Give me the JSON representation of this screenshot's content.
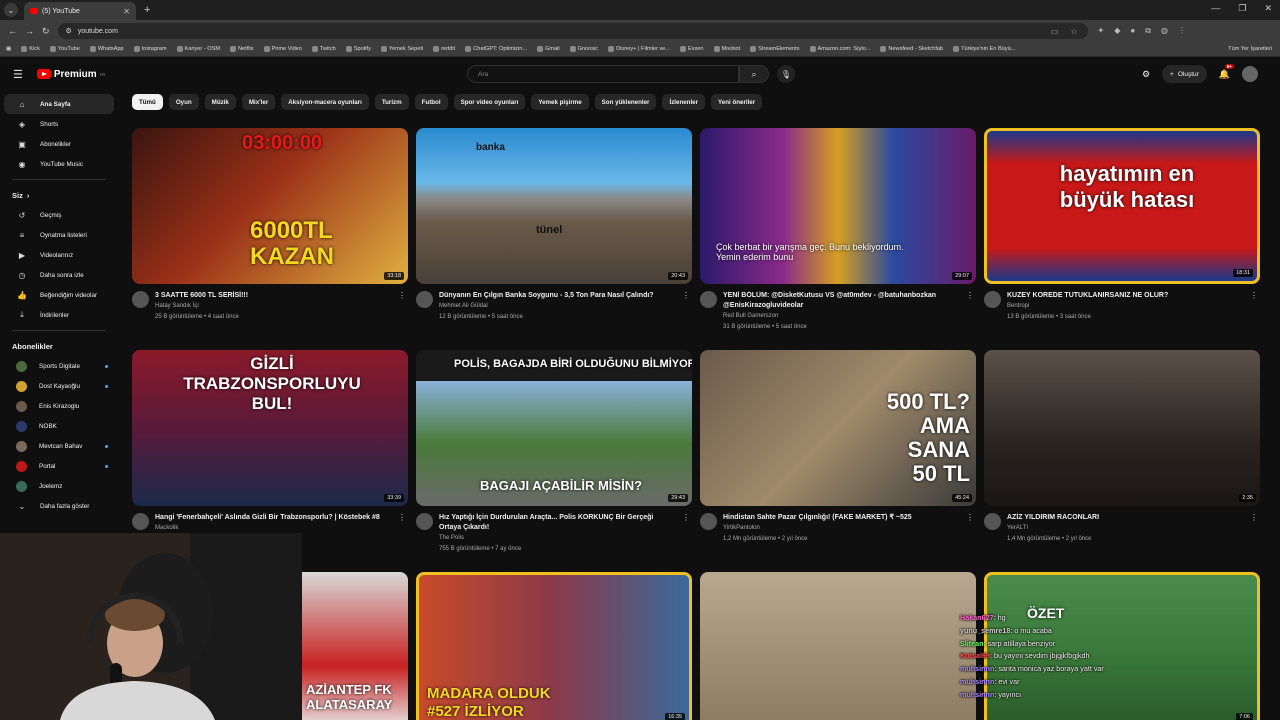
{
  "browser": {
    "tab_title": "(5) YouTube",
    "url": "youtube.com",
    "bookmarks": [
      "Kick",
      "YouTube",
      "WhatsApp",
      "Instagram",
      "Kariyer - OSM",
      "Netflix",
      "Prime Video",
      "Twitch",
      "Spotify",
      "Yemek Sepeti",
      "reddit",
      "ChatGPT: Optimizin...",
      "Gmail",
      "Gnoosic",
      "Disney+ | Filmler ve...",
      "Exxen",
      "Moobot",
      "StreamElements",
      "Amazon.com: Stylo...",
      "Newsfeed - Sketchfab",
      "Türkiye'nin En Büyü..."
    ],
    "bookmarks_all": "Tüm Yer İşaretleri"
  },
  "header": {
    "logo_text": "Premium",
    "logo_sup": "TR",
    "search_placeholder": "Ara",
    "create_label": "Oluştur",
    "notif_count": "9+"
  },
  "sidebar": {
    "main": [
      {
        "label": "Ana Sayfa",
        "icon": "home-icon",
        "glyph": "⌂"
      },
      {
        "label": "Shorts",
        "icon": "shorts-icon",
        "glyph": "◈"
      },
      {
        "label": "Abonelikler",
        "icon": "subscriptions-icon",
        "glyph": "▣"
      },
      {
        "label": "YouTube Music",
        "icon": "music-icon",
        "glyph": "◉"
      }
    ],
    "you_heading": "Siz",
    "you": [
      {
        "label": "Geçmiş",
        "icon": "history-icon",
        "glyph": "↺"
      },
      {
        "label": "Oynatma listeleri",
        "icon": "playlist-icon",
        "glyph": "≡"
      },
      {
        "label": "Videolarınız",
        "icon": "your-videos-icon",
        "glyph": "▶"
      },
      {
        "label": "Daha sonra izle",
        "icon": "watch-later-icon",
        "glyph": "◷"
      },
      {
        "label": "Beğendiğim videolar",
        "icon": "like-icon",
        "glyph": "👍"
      },
      {
        "label": "İndirilenler",
        "icon": "download-icon",
        "glyph": "⤓"
      }
    ],
    "subs_heading": "Abonelikler",
    "subs": [
      {
        "label": "Sports Digitale",
        "color": "#4a6a3a"
      },
      {
        "label": "Dost Kayaoğlu",
        "color": "#d0a030"
      },
      {
        "label": "Enis Kirazoglu",
        "color": "#6a5a4a"
      },
      {
        "label": "NOBK",
        "color": "#2a3a6a"
      },
      {
        "label": "Mevtcan Bahav",
        "color": "#7a6a5a"
      },
      {
        "label": "Portal",
        "color": "#c01818"
      },
      {
        "label": "Joelemz",
        "color": "#3a6a5a"
      }
    ],
    "more_label": "Daha fazla göster"
  },
  "chips": [
    "Tümü",
    "Oyun",
    "Müzik",
    "Mix'ler",
    "Aksiyon-macera oyunları",
    "Turizm",
    "Futbol",
    "Spor video oyunları",
    "Yemek pişirme",
    "Son yüklenenler",
    "İzlenenler",
    "Yeni öneriler"
  ],
  "videos": [
    {
      "title": "3 SAATTE 6000 TL SERİSİ!!!",
      "channel": "Hatay Sandık İçi",
      "stats": "25 B görüntüleme • 4 saat önce",
      "duration": "33:18",
      "overlay": "6000TL KAZAN",
      "overlay2": "03:00:00",
      "bg": "linear-gradient(135deg,#3a1510,#9a3018 45%,#e0b040)"
    },
    {
      "title": "Dünyanın En Çılgın Banka Soygunu - 3,5 Ton Para Nasıl Çalındı?",
      "channel": "Mehmet Ali Güldal",
      "stats": "12 B görüntüleme • 5 saat önce",
      "duration": "20:43",
      "overlay": "tünel",
      "overlay2": "banka",
      "bg": "linear-gradient(180deg,#2a8ad0 0%,#6ab8e8 35%,#8a8a8a 45%,#6a5a4a 60%,#4a4038)"
    },
    {
      "title": "YENİ BÖLÜM: @DisketKutusu VS @at0mdev - @batuhanbozkan @EnisKirazogluvideolar",
      "channel": "Red Bull Gamerszon",
      "stats": "31 B görüntüleme • 5 saat önce",
      "duration": "29:07",
      "overlay": "Çok berbat bir yarışma geç. Bunu bekliyordum. Yemin ederim bunu",
      "overlay2": "",
      "bg": "linear-gradient(90deg,#2a1a6a,#8a2a8a 30%,#d4a020 50%,#2a4aa0 70%,#6a1a6a)"
    },
    {
      "title": "KUZEY KOREDE TUTUKLANIRSANIZ NE OLUR?",
      "channel": "Bentropi",
      "stats": "13 B görüntüleme • 3 saat önce",
      "duration": "18:31",
      "overlay": "hayatımın en büyük hatası",
      "overlay2": "",
      "bg": "linear-gradient(180deg,#1a3a8a 0%,#c81818 22%,#c81818 78%,#1a3a8a 100%)"
    },
    {
      "title": "Hangi 'Fenerbahçeli' Aslında Gizli Bir Trabzonsporlu? | Köstebek #8",
      "channel": "Mackolik",
      "stats": "",
      "duration": "33:39",
      "overlay": "GİZLİ TRABZONSPORLUYU BUL!",
      "overlay2": "",
      "bg": "linear-gradient(180deg,#8a1a2a,#5a1a3a 50%,#1a2a4a)"
    },
    {
      "title": "Hız Yaptığı İçin Durdurulan Araçta... Polis KORKUNÇ Bir Gerçeği Ortaya Çıkardı!",
      "channel": "The Polis",
      "stats": "755 B görüntüleme • 7 ay önce",
      "duration": "29:43",
      "overlay": "BAGAJI AÇABİLİR MİSİN?",
      "overlay2": "POLİS, BAGAJDA BİRİ OLDUĞUNU BİLMİYORDU",
      "bg": "linear-gradient(180deg,#1a1a1a 0 20%,#8ab0d8 20%,#4a7a3a 60%,#6a6a6a)"
    },
    {
      "title": "Hindistan Sahte Pazar Çılgınlığı! (FAKE MARKET) ₹ ~525",
      "channel": "YirtikPantolon",
      "stats": "1,2 Mn görüntüleme • 2 yıl önce",
      "duration": "45:24",
      "overlay": "500 TL? AMA SANA 50 TL",
      "overlay2": "",
      "bg": "linear-gradient(135deg,#6a5a4a,#a08a6a 50%,#3a3a3a)"
    },
    {
      "title": "AZİZ YILDIRIM RACONLARI",
      "channel": "YerALTI",
      "stats": "1,4 Mn görüntüleme • 2 yıl önce",
      "duration": "2:35",
      "overlay": "",
      "overlay2": "",
      "bg": "linear-gradient(180deg,#5a5048,#2a2420 60%,#1a1614)"
    },
    {
      "title": "",
      "channel": "",
      "stats": "",
      "duration": "",
      "overlay": "AZİANTEP FK ALATASARAY",
      "overlay2": "",
      "bg": "linear-gradient(180deg,#d8d8d8,#c82020 60%,#e8e8e8)"
    },
    {
      "title": "",
      "channel": "",
      "stats": "",
      "duration": "16:35",
      "overlay": "MADARA OLDUK #527 İZLİYOR",
      "overlay2": "",
      "bg": "linear-gradient(90deg,#c84a2a,#8a3a4a 50%,#3a6a9a)"
    },
    {
      "title": "",
      "channel": "",
      "stats": "",
      "duration": "",
      "overlay": "",
      "overlay2": "",
      "bg": "linear-gradient(180deg,#b8a890,#8a7a60)"
    },
    {
      "title": "",
      "channel": "",
      "stats": "",
      "duration": "7:06",
      "overlay": "ÖZET",
      "overlay2": "",
      "bg": "linear-gradient(180deg,#4a8a4a,#3a7a3a 50%,#2a5a2a)"
    }
  ],
  "chat": [
    {
      "user": "Hakan627",
      "msg": ": hg",
      "color": "#ff66cc"
    },
    {
      "user": "yunu_semre18",
      "msg": ": o mu acaba",
      "color": "#d0d0d0"
    },
    {
      "user": "Slitean",
      "msg": ": sarp atillaya benziyor",
      "color": "#66ff66"
    },
    {
      "user": "Kutsal69",
      "msg": ": bu yayını sevdim jbjgjkfbgjkdh",
      "color": "#ff4a4a"
    },
    {
      "user": "muhsinnn",
      "msg": ": santa monica yaz boraya yatt var",
      "color": "#b08aff"
    },
    {
      "user": "muhsinnn",
      "msg": ": evi var",
      "color": "#b08aff"
    },
    {
      "user": "muhsinnn",
      "msg": ": yayıncı",
      "color": "#b08aff"
    }
  ]
}
